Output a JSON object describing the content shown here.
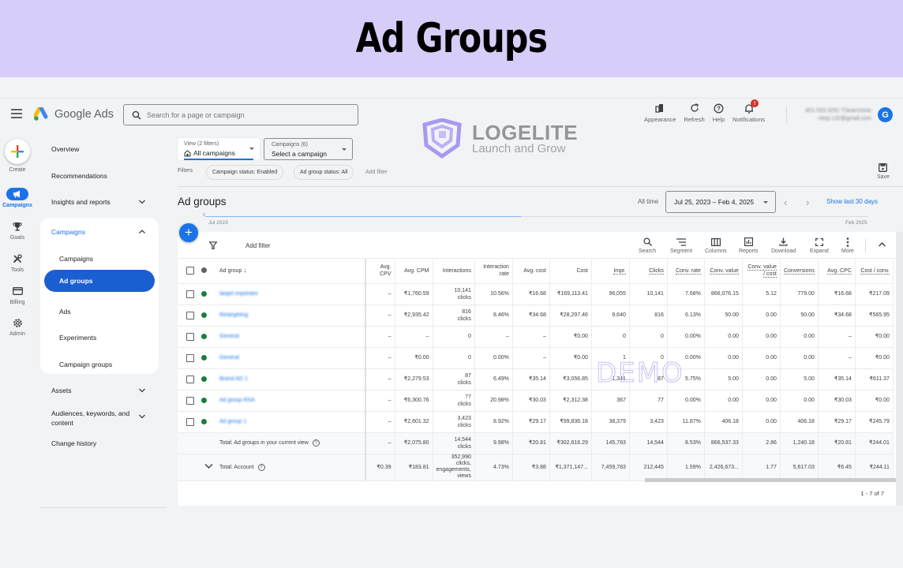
{
  "banner": {
    "title": "Ad Groups"
  },
  "brand": {
    "name": "Google Ads"
  },
  "search": {
    "placeholder": "Search for a page or campaign"
  },
  "top_actions": [
    {
      "label": "Appearance",
      "icon": "appearance-icon"
    },
    {
      "label": "Refresh",
      "icon": "refresh-icon"
    },
    {
      "label": "Help",
      "icon": "help-icon"
    },
    {
      "label": "Notifications",
      "icon": "bell-icon",
      "badge": "!"
    }
  ],
  "account": {
    "line1": "401-533-3291 TSearchAds",
    "line2": "nitsp.132@gmail.com",
    "avatar_glyph": "G"
  },
  "rail": [
    {
      "label": "Create",
      "icon": "plus-icon"
    },
    {
      "label": "Campaigns",
      "icon": "megaphone-icon",
      "active": true
    },
    {
      "label": "Goals",
      "icon": "trophy-icon"
    },
    {
      "label": "Tools",
      "icon": "tools-icon"
    },
    {
      "label": "Billing",
      "icon": "card-icon"
    },
    {
      "label": "Admin",
      "icon": "gear-icon"
    }
  ],
  "nav": {
    "overview": "Overview",
    "recommendations": "Recommendations",
    "insights": "Insights and reports",
    "campaigns_section": "Campaigns",
    "sub": [
      "Campaigns",
      "Ad groups",
      "Ads",
      "Experiments",
      "Campaign groups"
    ],
    "active_sub": "Ad groups",
    "assets": "Assets",
    "audiences": "Audiences, keywords, and content",
    "change_history": "Change history"
  },
  "view_select": {
    "label": "View (2 filters)",
    "value": "All campaigns"
  },
  "campaign_select": {
    "label": "Campaigns (6)",
    "value": "Select a campaign"
  },
  "filters": {
    "label": "Filters",
    "chips": [
      "Campaign status: Enabled",
      "Ad group status: All"
    ],
    "add": "Add filter"
  },
  "save_label": "Save",
  "watermark": {
    "brand": "LOGELITE",
    "tagline": "Launch and Grow",
    "demo": "DEMO"
  },
  "page_title": "Ad groups",
  "date": {
    "preset": "All time",
    "range": "Jul 25, 2023 – Feb 4, 2025",
    "show_last": "Show last 30 days"
  },
  "timeline": {
    "start": "Jul 2023",
    "end": "Feb 2025",
    "zero": "0"
  },
  "toolbar": {
    "add_filter": "Add filter",
    "buttons": [
      "Search",
      "Segment",
      "Columns",
      "Reports",
      "Download",
      "Expand",
      "More"
    ]
  },
  "table": {
    "columns": [
      "Ad group",
      "Avg. CPV",
      "Avg. CPM",
      "Interactions",
      "Interaction rate",
      "Avg. cost",
      "Cost",
      "Impr.",
      "Clicks",
      "Conv. rate",
      "Conv. value",
      "Conv. value / cost",
      "Conversions",
      "Avg. CPC",
      "Cost / conv."
    ],
    "rows": [
      {
        "name": "target impshare",
        "status": "enabled",
        "cells": [
          "–",
          "₹1,760.59",
          "10,141 clicks",
          "10.56%",
          "₹16.68",
          "₹169,113.41",
          "96,055",
          "10,141",
          "7.68%",
          "866,076.15",
          "5.12",
          "779.00",
          "₹16.68",
          "₹217.09"
        ]
      },
      {
        "name": "Retargeting",
        "status": "enabled",
        "cells": [
          "–",
          "₹2,935.42",
          "816 clicks",
          "8.46%",
          "₹34.68",
          "₹28,297.46",
          "9,640",
          "816",
          "6.13%",
          "50.00",
          "0.00",
          "50.00",
          "₹34.68",
          "₹565.95"
        ]
      },
      {
        "name": "General",
        "status": "enabled",
        "cells": [
          "–",
          "–",
          "0",
          "–",
          "–",
          "₹0.00",
          "0",
          "0",
          "0.00%",
          "0.00",
          "0.00",
          "0.00",
          "–",
          "₹0.00"
        ]
      },
      {
        "name": "General",
        "status": "enabled",
        "cells": [
          "–",
          "₹0.00",
          "0",
          "0.00%",
          "–",
          "₹0.00",
          "1",
          "0",
          "0.00%",
          "0.00",
          "0.00",
          "0.00",
          "–",
          "₹0.00"
        ]
      },
      {
        "name": "Brand AD 1",
        "status": "enabled",
        "cells": [
          "–",
          "₹2,279.53",
          "87 clicks",
          "6.49%",
          "₹35.14",
          "₹3,056.85",
          "1,341",
          "87",
          "5.75%",
          "5.00",
          "0.00",
          "5.00",
          "₹35.14",
          "₹611.37"
        ]
      },
      {
        "name": "Ad group RSA",
        "status": "enabled",
        "cells": [
          "–",
          "₹6,300.76",
          "77 clicks",
          "20.98%",
          "₹30.03",
          "₹2,312.38",
          "367",
          "77",
          "0.00%",
          "0.00",
          "0.00",
          "0.00",
          "₹30.03",
          "₹0.00"
        ]
      },
      {
        "name": "Ad group 1",
        "status": "enabled",
        "cells": [
          "–",
          "₹2,601.32",
          "3,423 clicks",
          "8.92%",
          "₹29.17",
          "₹99,836.18",
          "38,379",
          "3,423",
          "11.87%",
          "406.18",
          "0.00",
          "406.18",
          "₹29.17",
          "₹245.79"
        ]
      }
    ],
    "total_view": {
      "label": "Total: Ad groups in your current view",
      "cells": [
        "–",
        "₹2,075.80",
        "14,544 clicks",
        "9.98%",
        "₹20.81",
        "₹302,616.29",
        "145,783",
        "14,544",
        "8.53%",
        "866,537.33",
        "2.86",
        "1,240.18",
        "₹20.81",
        "₹244.01"
      ]
    },
    "total_account": {
      "label": "Total: Account",
      "cells": [
        "₹0.39",
        "₹183.81",
        "352,990 clicks, engagements, views",
        "4.73%",
        "₹3.88",
        "₹1,371,147...",
        "7,459,783",
        "212,445",
        "1.59%",
        "2,426,673...",
        "1.77",
        "5,617.03",
        "₹6.45",
        "₹244.11"
      ]
    },
    "pagination": "1 - 7 of 7"
  },
  "colors": {
    "accent": "#1a73e8",
    "status_enabled": "#188038",
    "banner_bg": "#d8ccf8"
  }
}
